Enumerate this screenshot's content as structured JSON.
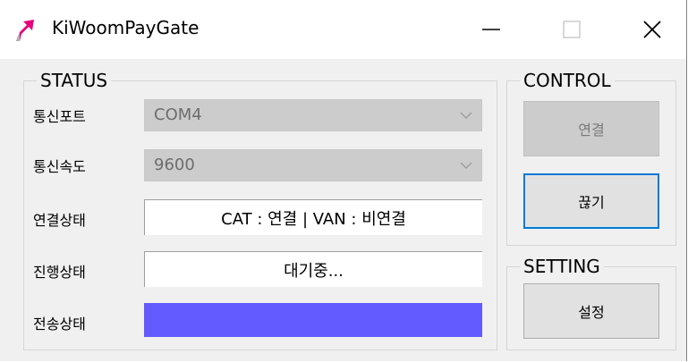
{
  "window": {
    "title": "KiWoomPayGate",
    "icons": {
      "logo": "kiwoom-arrow-logo",
      "minimize": "minimize-icon",
      "maximize": "maximize-icon",
      "close": "close-icon"
    }
  },
  "status": {
    "group_title": "STATUS",
    "port": {
      "label": "통신포트",
      "value": "COM4"
    },
    "speed": {
      "label": "통신속도",
      "value": "9600"
    },
    "connection": {
      "label": "연결상태",
      "value": "CAT : 연결 | VAN : 비연결"
    },
    "progress": {
      "label": "진행상태",
      "value": "대기중..."
    },
    "transfer": {
      "label": "전송상태",
      "progress_percent": 100,
      "color": "#635bff"
    }
  },
  "control": {
    "group_title": "CONTROL",
    "connect_label": "연결",
    "disconnect_label": "끊기"
  },
  "setting": {
    "group_title": "SETTING",
    "settings_label": "설정"
  }
}
